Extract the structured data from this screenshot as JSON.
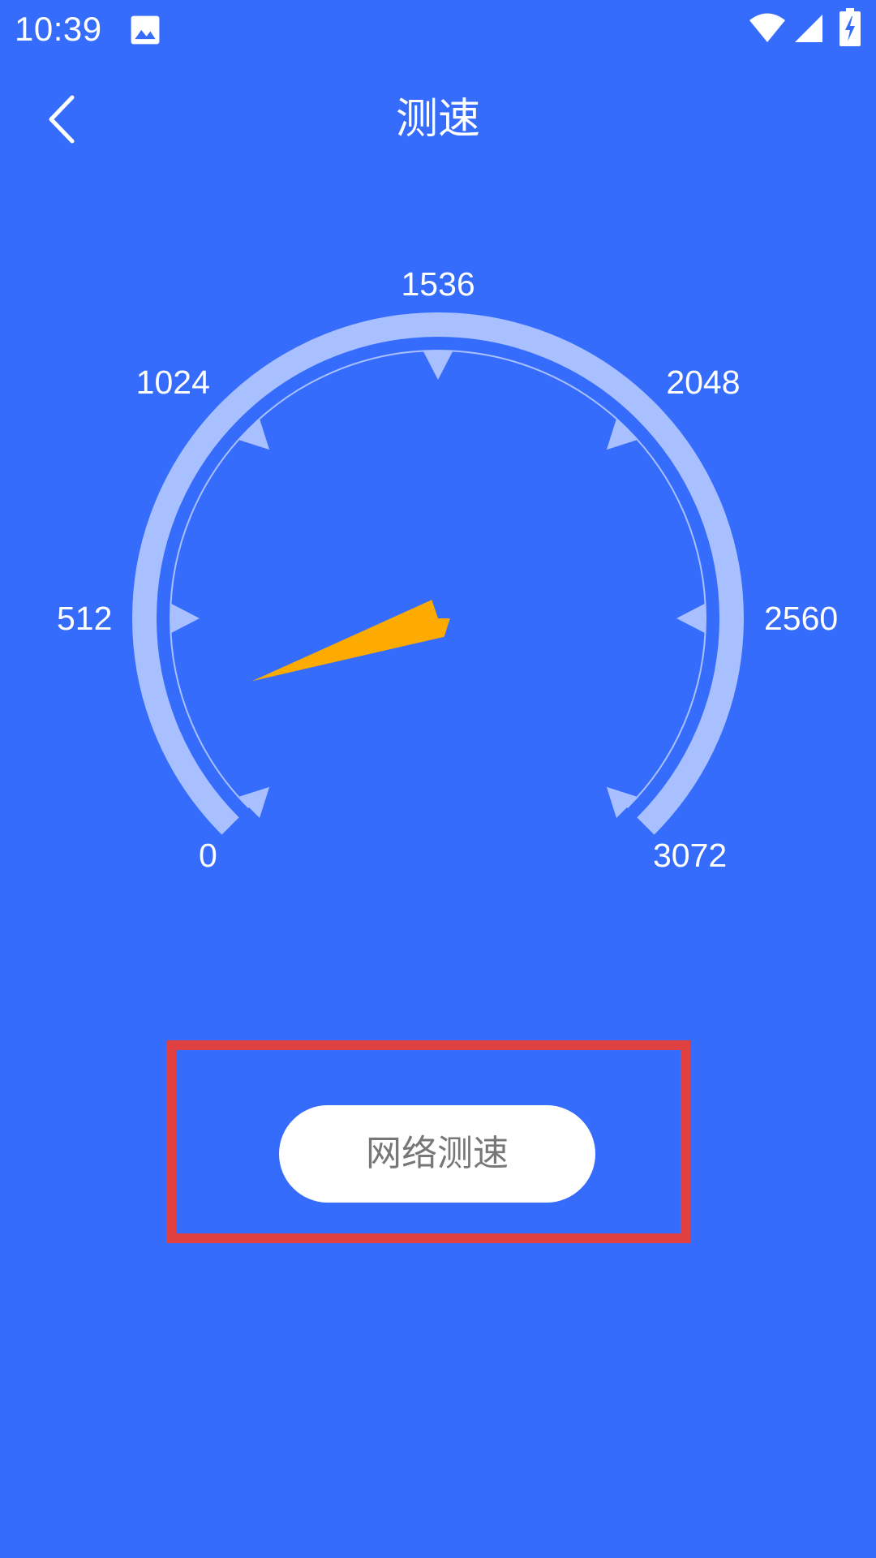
{
  "status_bar": {
    "time": "10:39",
    "icons": [
      "image-icon",
      "wifi-icon",
      "signal-icon",
      "battery-charging-icon"
    ]
  },
  "app_bar": {
    "title": "测速",
    "back_icon": "chevron-left-icon"
  },
  "gauge": {
    "min": 0,
    "max": 3072,
    "tick_labels": [
      "0",
      "512",
      "1024",
      "1536",
      "2048",
      "2560",
      "3072"
    ],
    "needle_value": 300,
    "needle_color": "#fdab00",
    "arc_color": "#a8c0ff"
  },
  "test_button": {
    "label": "网络测速",
    "highlight_color": "#e0403f"
  },
  "colors": {
    "background": "#366cfb",
    "text": "#ffffff",
    "button_text": "#777777"
  }
}
